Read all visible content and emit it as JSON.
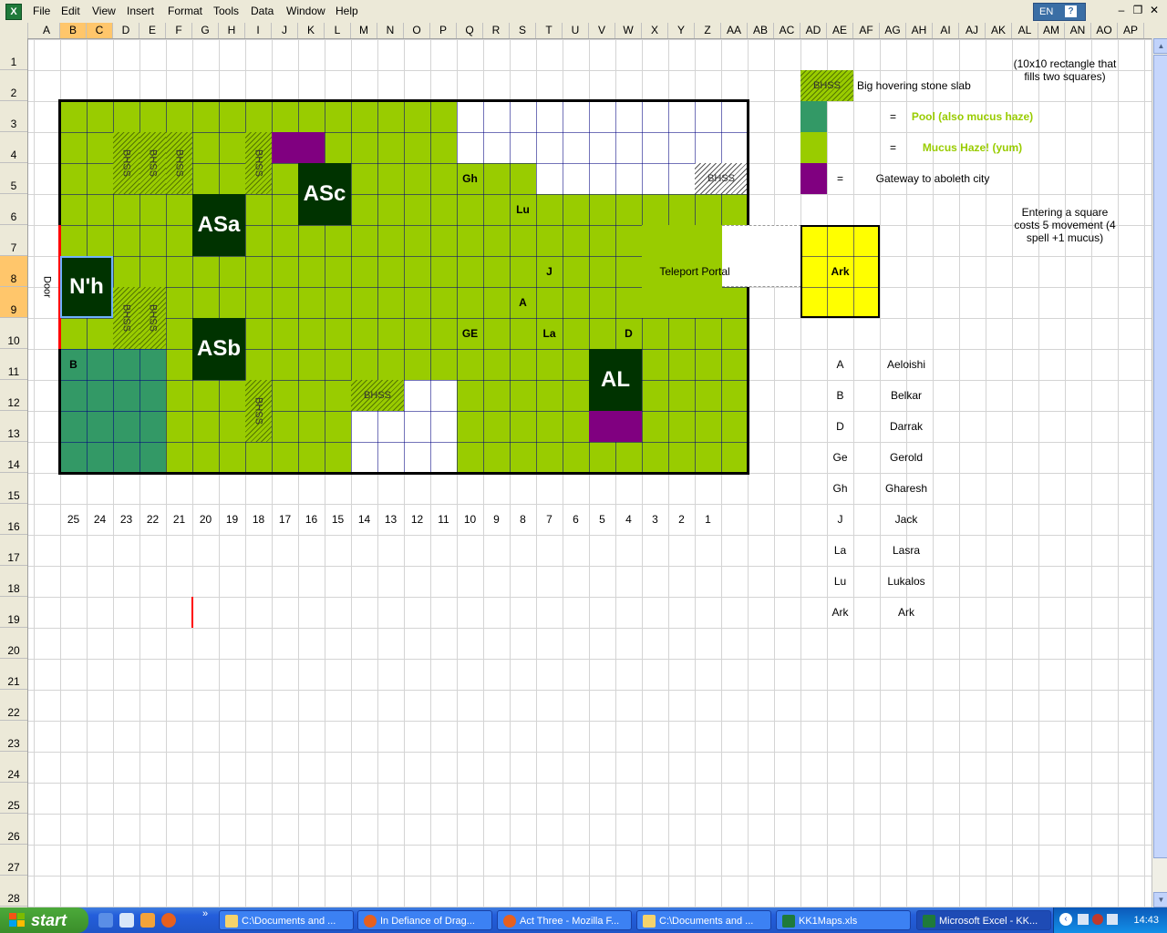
{
  "menu": {
    "items": [
      "File",
      "Edit",
      "View",
      "Insert",
      "Format",
      "Tools",
      "Data",
      "Window",
      "Help"
    ],
    "lang": "EN",
    "help_icon": "?",
    "min_icon": "minimize-icon",
    "restore_icon": "restore-icon",
    "close_icon": "close-icon"
  },
  "columns": [
    "A",
    "B",
    "C",
    "D",
    "E",
    "F",
    "G",
    "H",
    "I",
    "J",
    "K",
    "L",
    "M",
    "N",
    "O",
    "P",
    "Q",
    "R",
    "S",
    "T",
    "U",
    "V",
    "W",
    "X",
    "Y",
    "Z",
    "AA",
    "AB",
    "AC",
    "AD",
    "AE",
    "AF",
    "AG",
    "AH",
    "AI",
    "AJ",
    "AK",
    "AL",
    "AM",
    "AN",
    "AO",
    "AP"
  ],
  "rows": [
    "1",
    "2",
    "3",
    "4",
    "5",
    "6",
    "7",
    "8",
    "9",
    "10",
    "11",
    "12",
    "13",
    "14",
    "15",
    "16",
    "17",
    "18",
    "19",
    "20",
    "21",
    "22",
    "23",
    "24",
    "25",
    "26",
    "27",
    "28"
  ],
  "map": {
    "door": "Door",
    "bhss": "BHSS",
    "gh": "Gh",
    "lu": "Lu",
    "j": "J",
    "a": "A",
    "ge": "GE",
    "la": "La",
    "d": "D",
    "b": "B",
    "nh": "N'h",
    "asa": "ASa",
    "asb": "ASb",
    "asc": "ASc",
    "al": "AL",
    "teleport": "Teleport Portal"
  },
  "distance_numbers": [
    "25",
    "24",
    "23",
    "22",
    "21",
    "20",
    "19",
    "18",
    "17",
    "16",
    "15",
    "14",
    "13",
    "12",
    "11",
    "10",
    "9",
    "8",
    "7",
    "6",
    "5",
    "4",
    "3",
    "2",
    "1"
  ],
  "legend": {
    "note_rect": "(10x10 rectangle that fills two squares)",
    "bhss_label": "BHSS",
    "bhss_desc": "Big hovering stone slab",
    "eq": "=",
    "pool_desc": "Pool (also mucus haze)",
    "mucus_desc": "Mucus Haze! (yum)",
    "gateway_desc": "Gateway to aboleth city",
    "entering_note": "Entering a square costs 5 movement (4 spell +1 mucus)",
    "ark": "Ark"
  },
  "characters": [
    {
      "code": "A",
      "name": "Aeloishi"
    },
    {
      "code": "B",
      "name": "Belkar"
    },
    {
      "code": "D",
      "name": "Darrak"
    },
    {
      "code": "Ge",
      "name": "Gerold"
    },
    {
      "code": "Gh",
      "name": "Gharesh"
    },
    {
      "code": "J",
      "name": "Jack"
    },
    {
      "code": "La",
      "name": "Lasra"
    },
    {
      "code": "Lu",
      "name": "Lukalos"
    },
    {
      "code": "Ark",
      "name": "Ark"
    }
  ],
  "taskbar": {
    "start": "start",
    "tasks": [
      "C:\\Documents and ...",
      "In Defiance of Drag...",
      "Act Three - Mozilla F...",
      "C:\\Documents and ...",
      "KK1Maps.xls",
      "Microsoft Excel - KK..."
    ],
    "clock": "14:43"
  },
  "colors": {
    "mucus": "#99cc00",
    "pool": "#339966",
    "gateway": "#800080",
    "monster": "#003300",
    "ark": "#ffff00"
  }
}
